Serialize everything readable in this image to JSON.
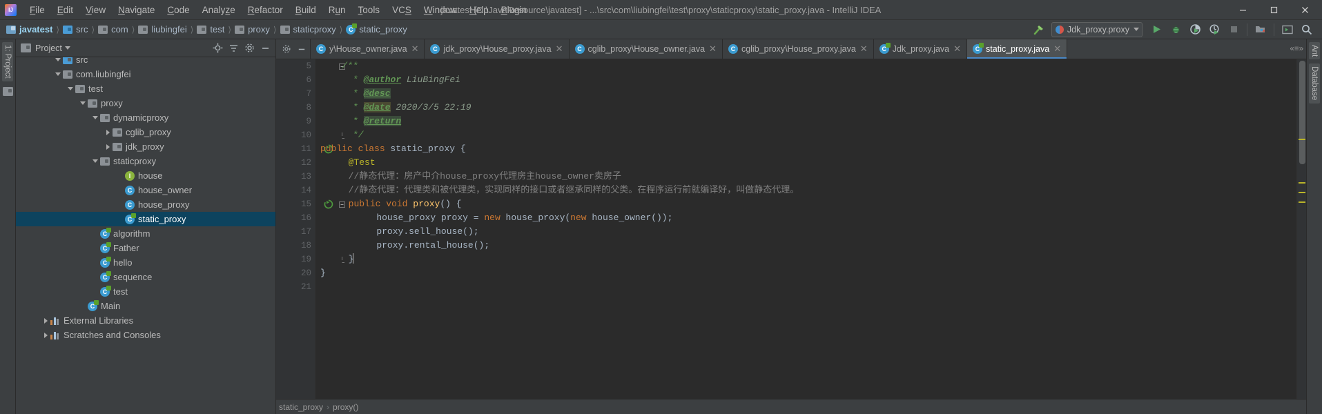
{
  "window": {
    "title": "javatest [D:\\JavaResource\\javatest] - ...\\src\\com\\liubingfei\\test\\proxy\\staticproxy\\static_proxy.java - IntelliJ IDEA",
    "logo_label": "IJ",
    "minimize": "—",
    "maximize": "❐",
    "close": "✕"
  },
  "menu": [
    {
      "label": "File",
      "mnemonic": "F"
    },
    {
      "label": "Edit",
      "mnemonic": "E"
    },
    {
      "label": "View",
      "mnemonic": "V"
    },
    {
      "label": "Navigate",
      "mnemonic": "N"
    },
    {
      "label": "Code",
      "mnemonic": "C"
    },
    {
      "label": "Analyze",
      "mnemonic": "z"
    },
    {
      "label": "Refactor",
      "mnemonic": "R"
    },
    {
      "label": "Build",
      "mnemonic": "B"
    },
    {
      "label": "Run",
      "mnemonic": "u"
    },
    {
      "label": "Tools",
      "mnemonic": "T"
    },
    {
      "label": "VCS",
      "mnemonic": "S"
    },
    {
      "label": "Window",
      "mnemonic": "W"
    },
    {
      "label": "Help",
      "mnemonic": "H"
    },
    {
      "label": "Plugin",
      "mnemonic": "P"
    }
  ],
  "breadcrumbs": [
    {
      "label": "javatest",
      "icon": "module-icon",
      "root": true
    },
    {
      "label": "src",
      "icon": "source-folder-icon"
    },
    {
      "label": "com",
      "icon": "package-icon"
    },
    {
      "label": "liubingfei",
      "icon": "package-icon"
    },
    {
      "label": "test",
      "icon": "package-icon"
    },
    {
      "label": "proxy",
      "icon": "package-icon"
    },
    {
      "label": "staticproxy",
      "icon": "package-icon"
    },
    {
      "label": "static_proxy",
      "icon": "class-icon"
    }
  ],
  "toolbar": {
    "build_icon": "hammer-icon",
    "run_config": "Jdk_proxy.proxy",
    "run_config_icon": "run-config-icon",
    "dropdown_icon": "chevron-down-icon",
    "buttons": [
      {
        "name": "run-button",
        "icon": "play-icon"
      },
      {
        "name": "debug-button",
        "icon": "bug-icon"
      },
      {
        "name": "run-with-coverage-button",
        "icon": "coverage-icon"
      },
      {
        "name": "profile-button",
        "icon": "profiler-icon"
      },
      {
        "name": "stop-button",
        "icon": "stop-icon"
      },
      {
        "name": "project-structure-button",
        "icon": "project-structure-icon"
      },
      {
        "name": "terminal-button",
        "icon": "terminal-icon"
      },
      {
        "name": "search-everywhere-button",
        "icon": "search-icon"
      }
    ]
  },
  "left_rail": {
    "label": "1: Project",
    "structure_icon": "structure-icon"
  },
  "right_rail": {
    "labels": [
      "Ant",
      "Database"
    ]
  },
  "project_panel": {
    "title": "Project",
    "dropdown_icon": "chevron-down-icon",
    "actions": [
      "locate-icon",
      "collapse-all-icon",
      "settings-icon",
      "hide-icon"
    ],
    "tree": [
      {
        "label": "src",
        "indent": 3,
        "toggle": "down",
        "icon": "source-folder-icon",
        "partial": true
      },
      {
        "label": "com.liubingfei",
        "indent": 3,
        "toggle": "down",
        "icon": "package-icon"
      },
      {
        "label": "test",
        "indent": 4,
        "toggle": "down",
        "icon": "package-icon"
      },
      {
        "label": "proxy",
        "indent": 5,
        "toggle": "down",
        "icon": "package-icon"
      },
      {
        "label": "dynamicproxy",
        "indent": 6,
        "toggle": "down",
        "icon": "package-icon"
      },
      {
        "label": "cglib_proxy",
        "indent": 7,
        "toggle": "right",
        "icon": "package-icon"
      },
      {
        "label": "jdk_proxy",
        "indent": 7,
        "toggle": "right",
        "icon": "package-icon"
      },
      {
        "label": "staticproxy",
        "indent": 6,
        "toggle": "down",
        "icon": "package-icon"
      },
      {
        "label": "house",
        "indent": 8,
        "toggle": "none",
        "icon": "interface-icon"
      },
      {
        "label": "house_owner",
        "indent": 8,
        "toggle": "none",
        "icon": "class-icon"
      },
      {
        "label": "house_proxy",
        "indent": 8,
        "toggle": "none",
        "icon": "class-icon"
      },
      {
        "label": "static_proxy",
        "indent": 8,
        "toggle": "none",
        "icon": "test-class-icon",
        "selected": true
      },
      {
        "label": "algorithm",
        "indent": 6,
        "toggle": "none",
        "icon": "test-class-icon"
      },
      {
        "label": "Father",
        "indent": 6,
        "toggle": "none",
        "icon": "test-class-icon"
      },
      {
        "label": "hello",
        "indent": 6,
        "toggle": "none",
        "icon": "test-class-icon"
      },
      {
        "label": "sequence",
        "indent": 6,
        "toggle": "none",
        "icon": "test-class-icon"
      },
      {
        "label": "test",
        "indent": 6,
        "toggle": "none",
        "icon": "test-class-icon"
      },
      {
        "label": "Main",
        "indent": 5,
        "toggle": "none",
        "icon": "test-class-icon"
      },
      {
        "label": "External Libraries",
        "indent": 2,
        "toggle": "right",
        "icon": "library-icon"
      },
      {
        "label": "Scratches and Consoles",
        "indent": 2,
        "toggle": "right",
        "icon": "scratches-icon"
      }
    ]
  },
  "editor_tabs": {
    "left_buttons": [
      "settings-icon",
      "hide-icon"
    ],
    "right_label": "«≡»",
    "tabs": [
      {
        "label": "y\\House_owner.java",
        "icon": "class-icon",
        "active": false,
        "clipped": true
      },
      {
        "label": "jdk_proxy\\House_proxy.java",
        "icon": "class-icon",
        "active": false
      },
      {
        "label": "cglib_proxy\\House_owner.java",
        "icon": "class-icon",
        "active": false
      },
      {
        "label": "cglib_proxy\\House_proxy.java",
        "icon": "class-icon",
        "active": false
      },
      {
        "label": "Jdk_proxy.java",
        "icon": "test-class-icon",
        "active": false
      },
      {
        "label": "static_proxy.java",
        "icon": "test-class-icon",
        "active": true
      }
    ]
  },
  "code": {
    "first_line": 5,
    "lines": [
      {
        "n": 5,
        "segments": [
          {
            "t": "/**",
            "c": "cm"
          }
        ],
        "indent": 1,
        "fold": "start"
      },
      {
        "n": 6,
        "segments": [
          {
            "t": "* ",
            "c": "cm"
          },
          {
            "t": "@author",
            "c": "tag"
          },
          {
            "t": " LiuBingFei",
            "c": "tagv"
          }
        ],
        "indent": 1.5
      },
      {
        "n": 7,
        "segments": [
          {
            "t": "* ",
            "c": "cm"
          },
          {
            "t": "@desc",
            "c": "tag hl"
          }
        ],
        "indent": 1.5
      },
      {
        "n": 8,
        "segments": [
          {
            "t": "* ",
            "c": "cm"
          },
          {
            "t": "@date",
            "c": "tag hl2"
          },
          {
            "t": " 2020/3/5 22:19",
            "c": "tagv"
          }
        ],
        "indent": 1.5
      },
      {
        "n": 9,
        "segments": [
          {
            "t": "* ",
            "c": "cm"
          },
          {
            "t": "@return",
            "c": "tag hl"
          }
        ],
        "indent": 1.5
      },
      {
        "n": 10,
        "segments": [
          {
            "t": "*/",
            "c": "cm"
          }
        ],
        "indent": 1.5,
        "fold": "end"
      },
      {
        "n": 11,
        "segments": [
          {
            "t": "public class",
            "c": "kw"
          },
          {
            "t": " static_proxy {",
            "c": "cls"
          }
        ],
        "indent": 0,
        "gutter_mark": "run-test-icon"
      },
      {
        "n": 12,
        "segments": [
          {
            "t": "@Test",
            "c": "anno"
          }
        ],
        "indent": 1.3
      },
      {
        "n": 13,
        "segments": [
          {
            "t": "//静态代理：房产中介house_proxy代理房主house_owner卖房子",
            "c": "cmt"
          }
        ],
        "indent": 1.3
      },
      {
        "n": 14,
        "segments": [
          {
            "t": "//静态代理：代理类和被代理类，实现同样的接口或者继承同样的父类。在程序运行前就编译好，叫做静态代理。",
            "c": "cmt"
          }
        ],
        "indent": 1.3
      },
      {
        "n": 15,
        "segments": [
          {
            "t": "public void",
            "c": "kw"
          },
          {
            "t": " ",
            "c": "cls"
          },
          {
            "t": "proxy",
            "c": "fn"
          },
          {
            "t": "() {",
            "c": "cls"
          }
        ],
        "indent": 1.3,
        "gutter_mark": "run-test-icon",
        "fold": "start"
      },
      {
        "n": 16,
        "segments": [
          {
            "t": "house_proxy proxy = ",
            "c": "cls"
          },
          {
            "t": "new",
            "c": "kw"
          },
          {
            "t": " house_proxy(",
            "c": "cls"
          },
          {
            "t": "new",
            "c": "kw"
          },
          {
            "t": " house_owner());",
            "c": "cls"
          }
        ],
        "indent": 2.6
      },
      {
        "n": 17,
        "segments": [
          {
            "t": "proxy.sell_house();",
            "c": "cls"
          }
        ],
        "indent": 2.6
      },
      {
        "n": 18,
        "segments": [
          {
            "t": "proxy.rental_house();",
            "c": "cls"
          }
        ],
        "indent": 2.6
      },
      {
        "n": 19,
        "segments": [
          {
            "t": "}",
            "c": "cls"
          }
        ],
        "indent": 1.3,
        "caret": true,
        "fold": "end"
      },
      {
        "n": 20,
        "segments": [
          {
            "t": "}",
            "c": "cls"
          }
        ],
        "indent": 0
      },
      {
        "n": 21,
        "segments": [],
        "indent": 0
      }
    ]
  },
  "status": {
    "breadcrumb": [
      "static_proxy",
      "proxy()"
    ],
    "separator": "›"
  },
  "colors": {
    "accent": "#4a88c7",
    "selection": "#0d435e",
    "editor_bg": "#2b2b2b",
    "chrome_bg": "#3c3f41",
    "comment": "#808080",
    "keyword": "#cc7832",
    "javadoc": "#629755",
    "annotation": "#bbb529",
    "method": "#ffc66d"
  }
}
